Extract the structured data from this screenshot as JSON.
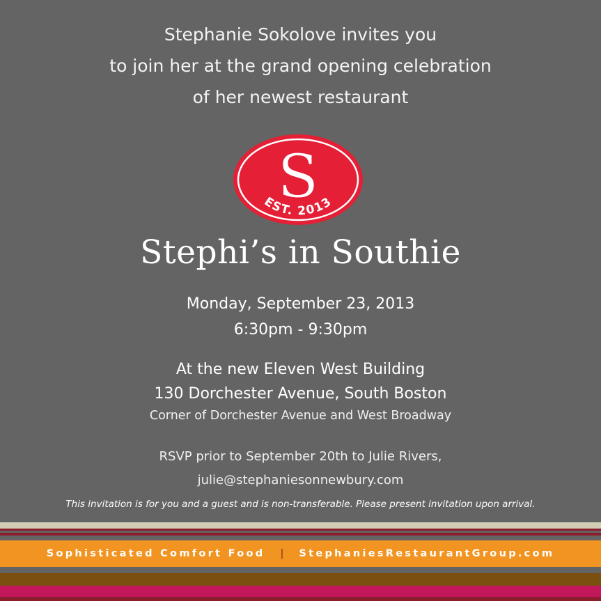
{
  "invitation": {
    "intro_line_1": "Stephanie Sokolove invites you",
    "intro_line_2": "to join her at the grand opening celebration",
    "intro_line_3": "of her newest restaurant"
  },
  "logo": {
    "monogram": "S",
    "established": "EST. 2013",
    "color": "#e41f36"
  },
  "restaurant_name": "Stephi’s in Southie",
  "event": {
    "date": "Monday, September 23, 2013",
    "time": "6:30pm - 9:30pm"
  },
  "location": {
    "venue": "At the new Eleven West Building",
    "address": "130 Dorchester Avenue, South Boston",
    "corner": "Corner of Dorchester Avenue and West Broadway"
  },
  "rsvp": {
    "text": "RSVP prior to September 20th to Julie Rivers,",
    "email": "julie@stephaniesonnewbury.com"
  },
  "note": "This invitation is for you and a guest and is non-transferable.  Please present invitation upon arrival.",
  "footer": {
    "tagline": "Sophisticated Comfort Food",
    "separator": "|",
    "website": "StephaniesRestaurantGroup.com",
    "band_color": "#f29421"
  },
  "colors": {
    "background": "#656464",
    "stripe_beige": "#d2cdb4",
    "stripe_maroon": "#8b1d2c",
    "stripe_brown": "#7a4f10",
    "stripe_magenta": "#c2185b"
  }
}
